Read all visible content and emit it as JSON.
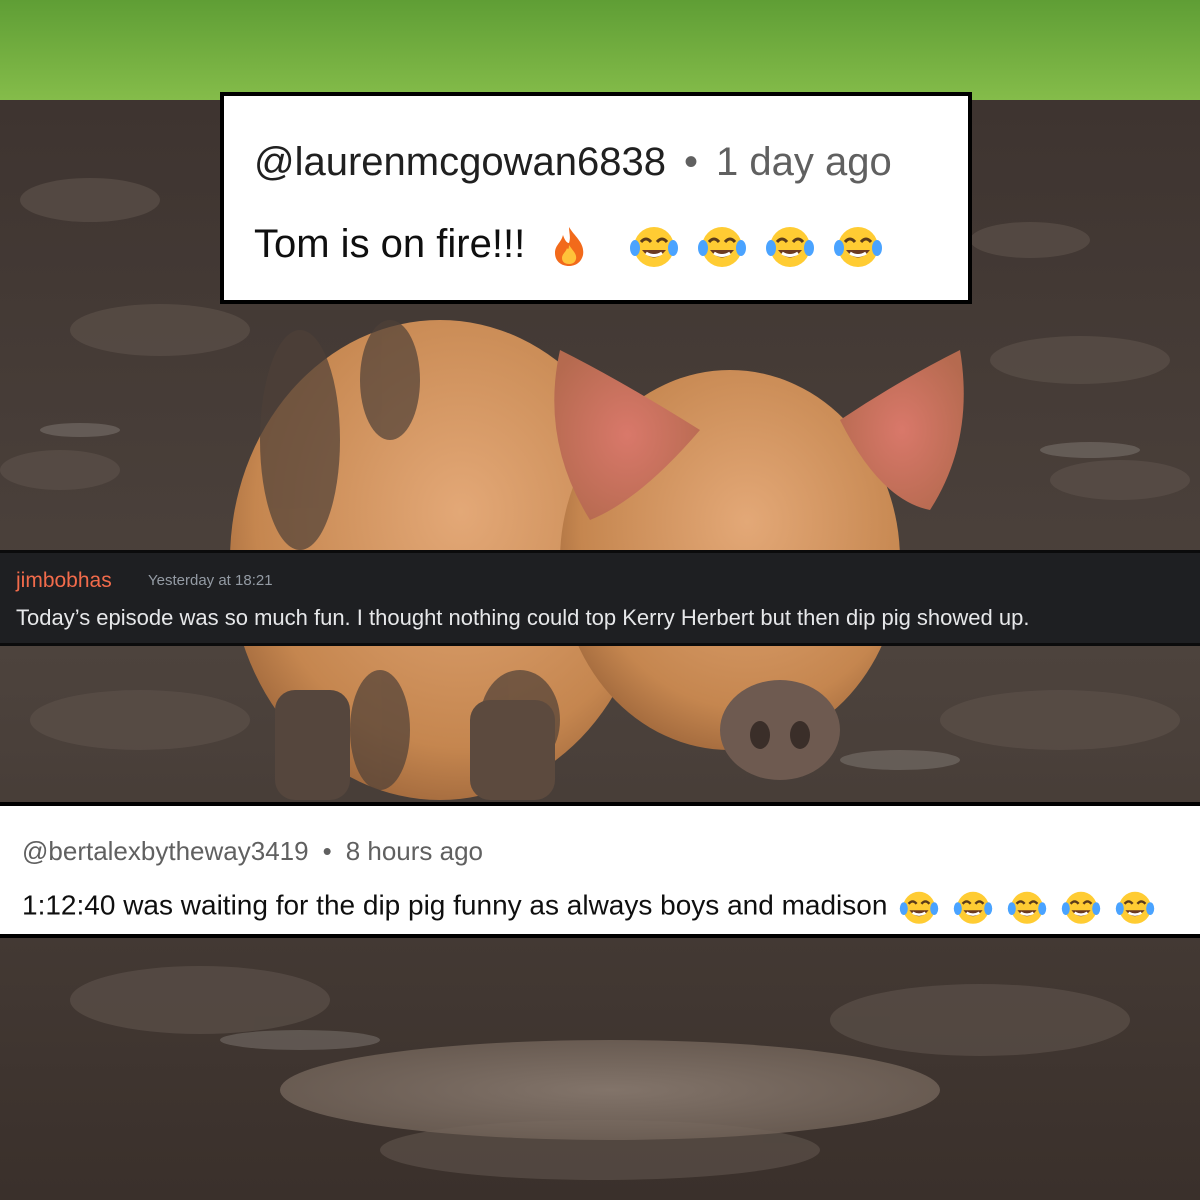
{
  "scene": {
    "colors": {
      "grass": "#6fb43a",
      "mud": "#4a3f38",
      "pig": "#c98a5a"
    }
  },
  "comment_top": {
    "username": "@laurenmcgowan6838",
    "separator": "•",
    "time": "1 day ago",
    "text": "Tom is on fire!!!",
    "emojis": [
      "fire-icon",
      "laughing-emoji-icon",
      "laughing-emoji-icon",
      "laughing-emoji-icon",
      "laughing-emoji-icon"
    ]
  },
  "discord_message": {
    "username": "jimbobhas",
    "timestamp": "Yesterday at 18:21",
    "text": "Today’s episode was so much fun. I thought nothing could top Kerry Herbert but then dip pig showed up.",
    "colors": {
      "background": "#1e1f22",
      "username": "#f26b4b",
      "text": "#e6e7e9"
    }
  },
  "comment_bottom": {
    "username": "@bertalexbytheway3419",
    "separator": "•",
    "time": "8 hours ago",
    "text": "1:12:40 was waiting for the dip pig funny as always boys and madison",
    "emojis": [
      "laughing-emoji-icon",
      "laughing-emoji-icon",
      "laughing-emoji-icon",
      "laughing-emoji-icon",
      "laughing-emoji-icon"
    ]
  }
}
